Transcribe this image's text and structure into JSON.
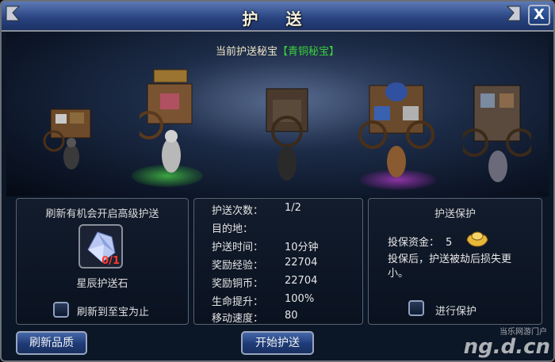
{
  "window": {
    "title": "护 送",
    "close_label": "X"
  },
  "header": {
    "current_prefix": "当前护送秘宝",
    "current_level": "【青铜秘宝】"
  },
  "refresh_panel": {
    "title": "刷新有机会开启高级护送",
    "item_count": "0/1",
    "item_name": "星辰护送石",
    "checkbox_label": "刷新到至宝为止",
    "checked": false
  },
  "info_panel": {
    "rows": [
      {
        "label": "护送次数：",
        "value": "1/2"
      },
      {
        "label": "目的地：",
        "value": ""
      },
      {
        "label": "护送时间：",
        "value": "10分钟"
      },
      {
        "label": "奖励经验：",
        "value": "22704"
      },
      {
        "label": "奖励铜币：",
        "value": "22704"
      },
      {
        "label": "生命提升：",
        "value": "100%"
      },
      {
        "label": "移动速度：",
        "value": "80"
      }
    ]
  },
  "protect_panel": {
    "title": "护送保护",
    "cost_label": "投保资金：",
    "cost_value": "5",
    "description": "投保后，护送被劫后损失更小。",
    "checkbox_label": "进行保护",
    "checked": false
  },
  "buttons": {
    "refresh": "刷新品质",
    "start": "开始护送"
  },
  "watermark": {
    "main": "ng.d.cn",
    "sub": "当乐网游门户"
  },
  "colors": {
    "level_green": "#39d13a",
    "count_red": "#ff3b2b",
    "gold": "#e7b93a"
  }
}
